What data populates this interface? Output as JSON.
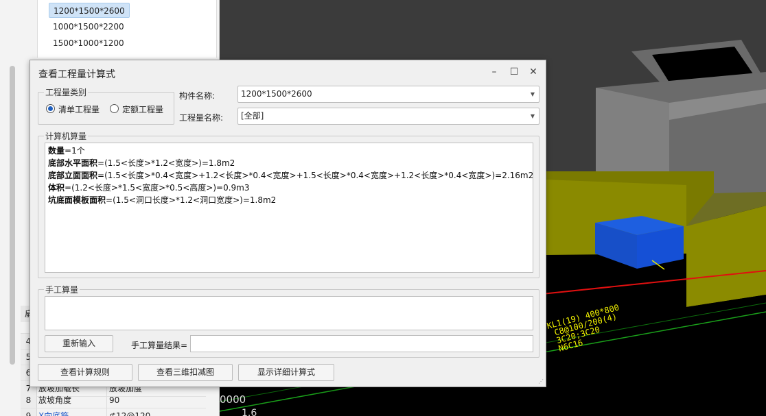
{
  "tree": {
    "items": [
      "1200*1500*2600",
      "1000*1500*2200",
      "1500*1000*1200"
    ],
    "selected_index": 0
  },
  "props": {
    "header_fragment": "扁",
    "rows": [
      {
        "num": "4",
        "name": "",
        "value": ""
      },
      {
        "num": "5",
        "name": "",
        "value": ""
      },
      {
        "num": "6",
        "name": "",
        "value": ""
      },
      {
        "num": "7",
        "name": "放坡加载长",
        "value": "放坡加度"
      },
      {
        "num": "8",
        "name": "放坡角度",
        "value": "90"
      },
      {
        "num": "9",
        "name": "X向底筋",
        "value": "⊈12@120"
      }
    ]
  },
  "viewport": {
    "annotation_lines": [
      "KL1(19) 400*800",
      "C8@100/200(4)",
      "3C20;3C20",
      "N6C16"
    ],
    "bottom_label_1": "0000",
    "bottom_label_2": "1.6"
  },
  "dialog": {
    "title": "查看工程量计算式",
    "qty_type_label": "工程量类别",
    "radio_list": "清单工程量",
    "radio_quota": "定额工程量",
    "radio_selected": "list",
    "component_name_label": "构件名称:",
    "component_name_value": "1200*1500*2600",
    "qty_name_label": "工程量名称:",
    "qty_name_value": "[全部]",
    "computer_calc_label": "计算机算量",
    "formulas": [
      {
        "name": "数量",
        "expr": "=1个"
      },
      {
        "name": "底部水平面积",
        "expr": "=(1.5<长度>*1.2<宽度>)=1.8m2"
      },
      {
        "name": "底部立面面积",
        "expr": "=(1.5<长度>*0.4<宽度>+1.2<长度>*0.4<宽度>+1.5<长度>*0.4<宽度>+1.2<长度>*0.4<宽度>)=2.16m2"
      },
      {
        "name": "体积",
        "expr": "=(1.2<长度>*1.5<宽度>*0.5<高度>)=0.9m3"
      },
      {
        "name": "坑底面模板面积",
        "expr": "=(1.5<洞口长度>*1.2<洞口宽度>)=1.8m2"
      }
    ],
    "manual_calc_label": "手工算量",
    "reinput_button": "重新输入",
    "manual_result_label": "手工算量结果=",
    "manual_result_value": "",
    "view_rules_button": "查看计算规则",
    "view_3d_button": "查看三维扣减图",
    "show_detail_button": "显示详细计算式"
  }
}
